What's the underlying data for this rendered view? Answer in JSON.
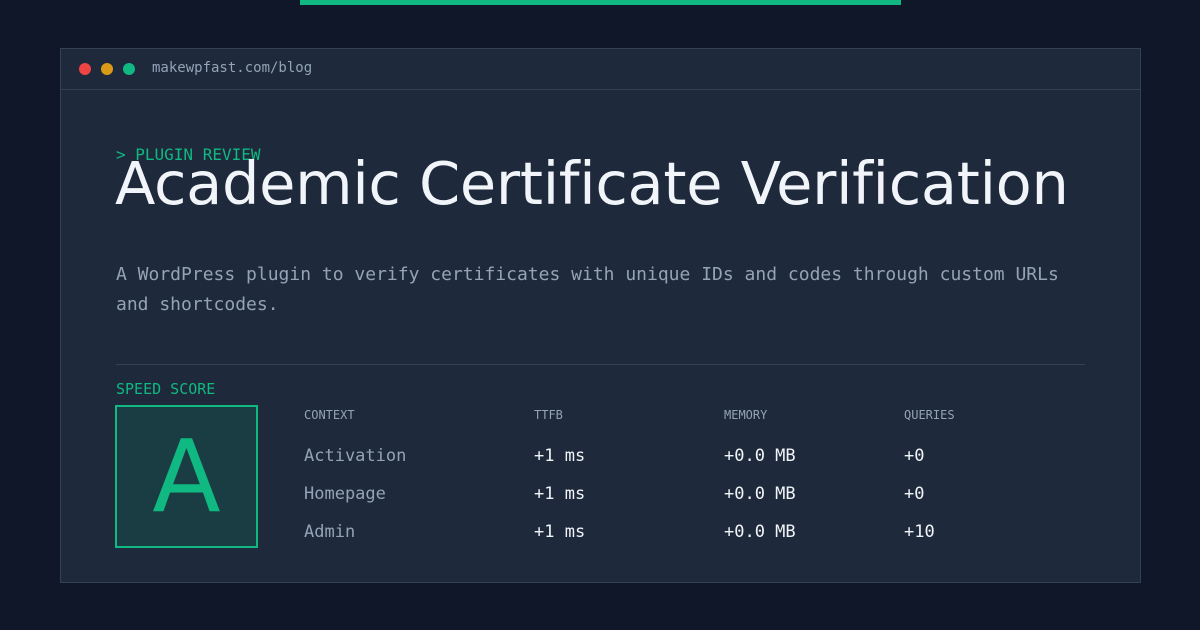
{
  "header": {
    "url": "makewpfast.com/blog"
  },
  "article": {
    "eyebrow": "> PLUGIN REVIEW",
    "title": "Academic Certificate Verification",
    "description": "A WordPress plugin to verify certificates with unique IDs and codes through custom URLs and shortcodes."
  },
  "score": {
    "label": "SPEED SCORE",
    "grade": "A"
  },
  "table": {
    "headers": [
      "CONTEXT",
      "TTFB",
      "MEMORY",
      "QUERIES"
    ],
    "rows": [
      [
        "Activation",
        "+1 ms",
        "+0.0 MB",
        "+0"
      ],
      [
        "Homepage",
        "+1 ms",
        "+0.0 MB",
        "+0"
      ],
      [
        "Admin",
        "+1 ms",
        "+0.0 MB",
        "+10"
      ]
    ]
  },
  "colors": {
    "accent": "#10b981",
    "background": "#0f1729",
    "panel": "#1e293b",
    "window_close": "#ef4444",
    "window_minimize": "#d99a17",
    "window_maximize": "#10b981"
  }
}
